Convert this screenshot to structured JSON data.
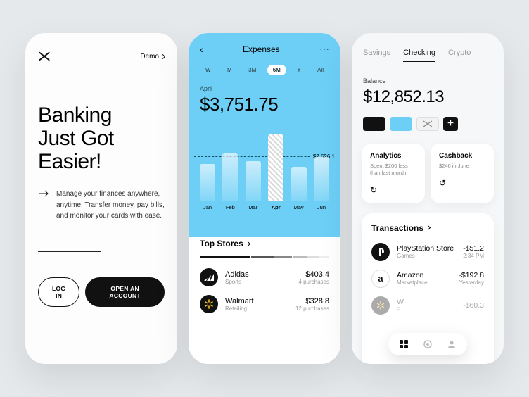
{
  "s1": {
    "demo": "Demo",
    "hero_l1": "Banking",
    "hero_l2": "Just Got",
    "hero_l3": "Easier!",
    "subtitle": "Manage your finances anywhere, anytime. Transfer money, pay bills, and monitor your cards with ease.",
    "login": "LOG IN",
    "open": "OPEN AN ACCOUNT"
  },
  "s2": {
    "title": "Expenses",
    "ranges": [
      "W",
      "M",
      "3M",
      "6M",
      "Y",
      "All"
    ],
    "active_range": "6M",
    "month": "April",
    "amount": "$3,751.75",
    "ref_value": "$2,626.1",
    "top_stores_title": "Top Stores",
    "stores": [
      {
        "name": "Adidas",
        "cat": "Sports",
        "amt": "$403.4",
        "cnt": "4 purchases"
      },
      {
        "name": "Walmart",
        "cat": "Retailing",
        "amt": "$328.8",
        "cnt": "12 purchases"
      }
    ]
  },
  "s3": {
    "tabs": [
      "Savings",
      "Checking",
      "Crypto"
    ],
    "active_tab": "Checking",
    "balance_label": "Balance",
    "balance": "$12,852.13",
    "analytics_title": "Analytics",
    "analytics_sub": "Spent $200 less than last month",
    "cashback_title": "Cashback",
    "cashback_sub": "$246 in June",
    "txn_title": "Transactions",
    "txns": [
      {
        "name": "PlayStation Store",
        "cat": "Games",
        "amt": "-$51.2",
        "time": "2:34 PM"
      },
      {
        "name": "Amazon",
        "cat": "Marketplace",
        "amt": "-$192.8",
        "time": "Yesterday"
      },
      {
        "name": "W",
        "cat": "R",
        "amt": "-$60.3",
        "time": ""
      }
    ]
  },
  "chart_data": {
    "type": "bar",
    "title": "Expenses",
    "categories": [
      "Jan",
      "Feb",
      "Mar",
      "Apr",
      "May",
      "Jun"
    ],
    "values": [
      2050,
      2700,
      2200,
      3751.75,
      1900,
      2450
    ],
    "highlight_index": 3,
    "reference_line": 2626.1,
    "ylim": [
      0,
      4000
    ],
    "xlabel": "",
    "ylabel": ""
  }
}
